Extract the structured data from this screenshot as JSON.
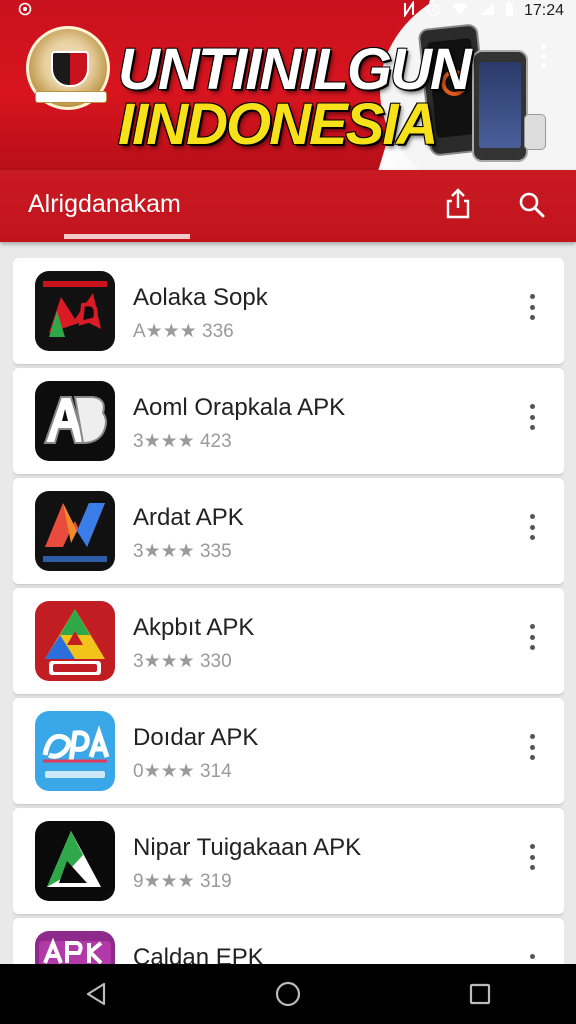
{
  "status_bar": {
    "time": "17:24"
  },
  "banner": {
    "title_line1": "UNTIINILGUN",
    "title_line2": "IINDONESIA"
  },
  "app_bar": {
    "title": "Alrigdanakam",
    "share_icon": "share-icon",
    "search_icon": "search-icon"
  },
  "apps": [
    {
      "name": "Aolaka Sopk",
      "meta": "A★★★ 336",
      "icon": "black-red-green-logo"
    },
    {
      "name": "Aoml Orapkala APK",
      "meta": "3★★★ 423",
      "icon": "black-white-ab-logo"
    },
    {
      "name": "Ardat APK",
      "meta": "3★★★ 335",
      "icon": "black-gradient-n-logo"
    },
    {
      "name": "Akpbıt APK",
      "meta": "3★★★ 330",
      "icon": "red-triangle-apk-logo"
    },
    {
      "name": "Doıdar APK",
      "meta": "0★★★ 314",
      "icon": "blue-apk-logo"
    },
    {
      "name": "Nipar Tuigakaan APK",
      "meta": "9★★★ 319",
      "icon": "black-green-a-logo"
    },
    {
      "name": "Caldan EPK",
      "meta": "",
      "icon": "purple-apk-logo"
    }
  ],
  "nav_bar": {
    "back": "back-icon",
    "home": "home-icon",
    "recents": "recents-icon"
  },
  "colors": {
    "brand_red": "#c8121d",
    "title_yellow": "#f7e21a"
  }
}
